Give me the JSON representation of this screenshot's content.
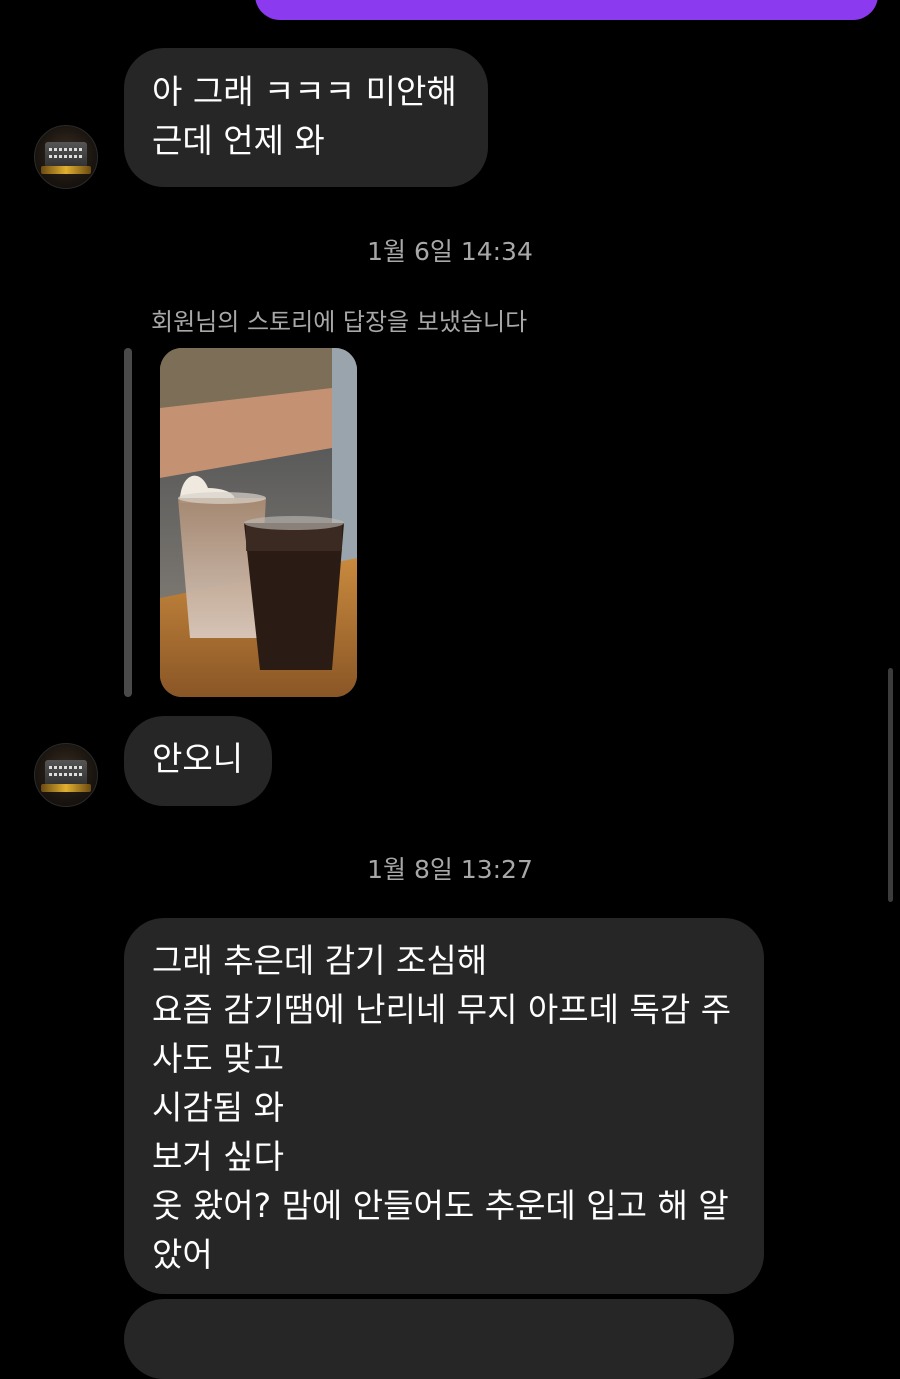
{
  "messages": {
    "m1": {
      "lines": [
        "아 그래 ㅋㅋㅋ 미안해",
        "근데 언제 와"
      ]
    },
    "m2": {
      "lines": [
        "안오니"
      ]
    },
    "m3": {
      "lines": [
        "그래 추은데 감기 조심해",
        "요즘 감기땜에 난리네 무지 아프데 독감 주",
        "사도 맞고",
        "시감됨 와",
        "보거 싶다",
        "옷 왔어? 맘에 안들어도 추운데 입고 해 알",
        "았어"
      ]
    }
  },
  "timestamps": {
    "t1": "1월 6일 14:34",
    "t2": "1월 8일 13:27"
  },
  "story_reply": {
    "caption": "회원님의 스토리에 답장을 보냈습니다",
    "image_desc_icon": "story-photo"
  },
  "colors": {
    "background": "#000000",
    "received_bubble": "#262626",
    "sent_bubble": "#8c3af0",
    "secondary_text": "#a8a8a8"
  }
}
